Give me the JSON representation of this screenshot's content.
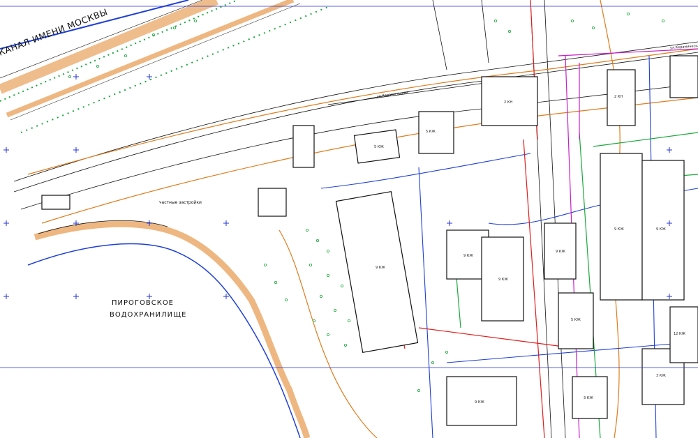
{
  "map": {
    "labels": {
      "canal": "КАНАЛ ИМЕНИ МОСКВЫ",
      "reservoir_1": "ПИРОГОВСКОЕ",
      "reservoir_2": "ВОДОХРАНИЛИЩЕ",
      "private_houses": "частные застройки",
      "street_1": "ул.Керамическая",
      "street_2": "ул.Керамическая"
    },
    "building_labels": [
      "2 КН",
      "5 КЖ",
      "9 КЖ",
      "9 КЖ",
      "9 КЖ",
      "9 КЖ",
      "9 КЖ",
      "5 КЖ",
      "3 КЖ",
      "9 КЖ",
      "9 КЖ",
      "5 КЖ",
      "2 КН",
      "3 КЖ",
      "12 КЖ"
    ],
    "colors": {
      "background": "#ffffff",
      "orange": "#e07b1a",
      "blue": "#1e3fd6",
      "red": "#e01c1c",
      "green": "#1aa83a",
      "magenta": "#c61fc9",
      "black": "#111111",
      "grid_blue": "#2433d6"
    }
  }
}
